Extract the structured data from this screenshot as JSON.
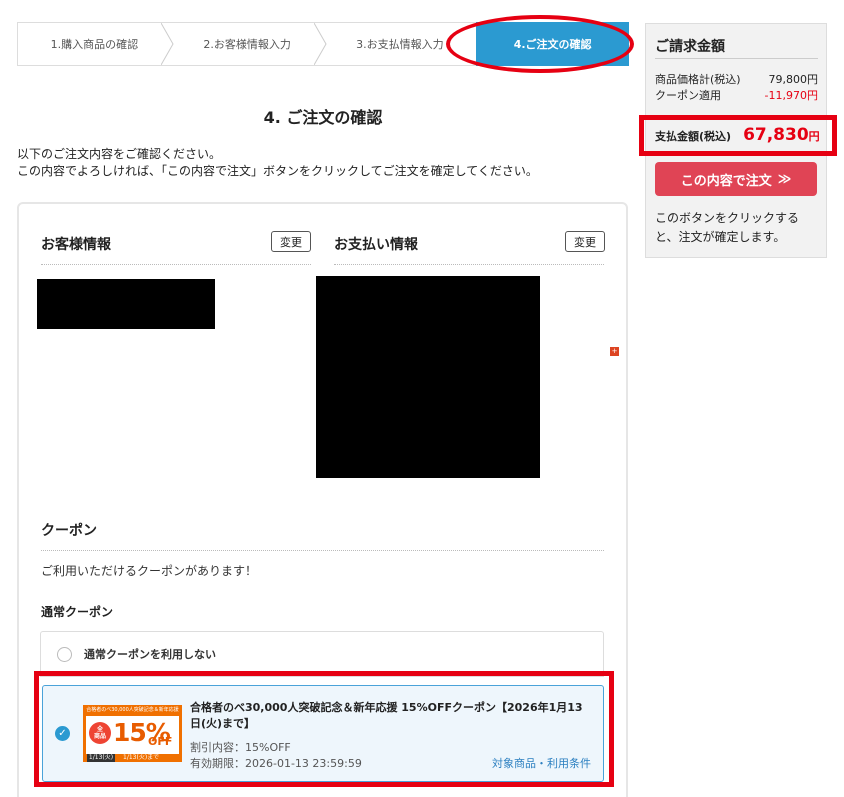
{
  "steps": [
    {
      "label": "1.購入商品の確認"
    },
    {
      "label": "2.お客様情報入力"
    },
    {
      "label": "3.お支払情報入力"
    },
    {
      "label": "4.ご注文の確認"
    }
  ],
  "page": {
    "title": "4. ご注文の確認",
    "intro_line1": "以下のご注文内容をご確認ください。",
    "intro_line2": "この内容でよろしければ、「この内容で注文」ボタンをクリックしてご注文を確定してください。"
  },
  "customer": {
    "heading": "お客様情報",
    "change_label": "変更"
  },
  "payment": {
    "heading": "お支払い情報",
    "change_label": "変更"
  },
  "coupon": {
    "heading": "クーポン",
    "message": "ご利用いただけるクーポンがあります！",
    "subheading": "通常クーポン",
    "none_option": "通常クーポンを利用しない",
    "item": {
      "title": "合格者のべ30,000人突破記念＆新年応援 15%OFFクーポン【2026年1月13日(火)まで】",
      "discount": "割引内容：15%OFF",
      "expiry": "有効期限：2026-01-13 23:59:59",
      "link": "対象商品・利用条件",
      "banner_top": "合格者のべ30,000人突破記念＆新年応援",
      "banner_badge_1": "全",
      "banner_badge_2": "商品",
      "banner_pct": "15%",
      "banner_off": "OFF",
      "banner_bottom_left": "1/13(火)",
      "banner_bottom_right": "1/13(火)まで"
    }
  },
  "summary": {
    "title": "ご請求金額",
    "subtotal_label": "商品価格計(税込)",
    "subtotal_value": "79,800円",
    "coupon_label": "クーポン適用",
    "coupon_value": "-11,970円",
    "total_label": "支払金額(税込)",
    "total_value": "67,830",
    "total_unit": "円",
    "order_button": "この内容で注文",
    "order_button_icon": "≫",
    "note": "このボタンをクリックすると、注文が確定します。"
  },
  "colors": {
    "accent": "#2b9ad1",
    "highlight": "#e60012",
    "order_button": "#e04455"
  }
}
